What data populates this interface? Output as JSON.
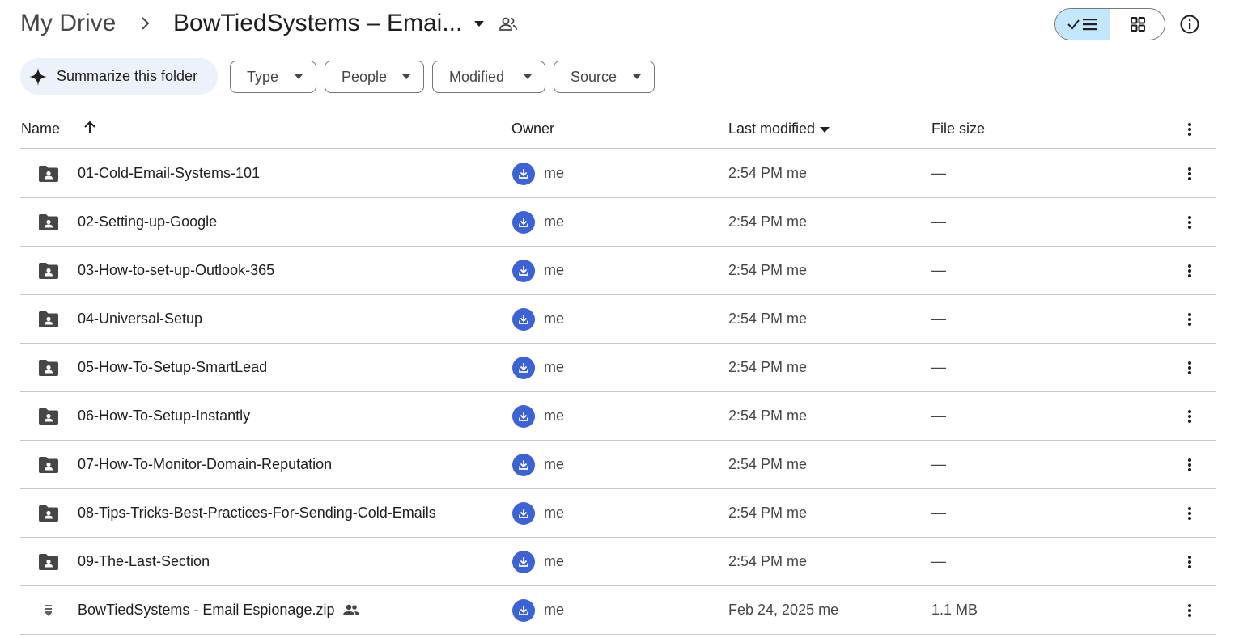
{
  "breadcrumb": {
    "root": "My Drive",
    "current": "BowTiedSystems – Emai..."
  },
  "actions": {
    "summarize_label": "Summarize this folder"
  },
  "filters": [
    {
      "label": "Type"
    },
    {
      "label": "People"
    },
    {
      "label": "Modified"
    },
    {
      "label": "Source"
    }
  ],
  "columns": {
    "name": "Name",
    "owner": "Owner",
    "last_modified": "Last modified",
    "file_size": "File size"
  },
  "rows": [
    {
      "type": "shared-folder",
      "name": "01-Cold-Email-Systems-101",
      "owner": "me",
      "modified": "2:54 PM  me",
      "size": "—"
    },
    {
      "type": "shared-folder",
      "name": "02-Setting-up-Google",
      "owner": "me",
      "modified": "2:54 PM  me",
      "size": "—"
    },
    {
      "type": "shared-folder",
      "name": "03-How-to-set-up-Outlook-365",
      "owner": "me",
      "modified": "2:54 PM  me",
      "size": "—"
    },
    {
      "type": "shared-folder",
      "name": "04-Universal-Setup",
      "owner": "me",
      "modified": "2:54 PM  me",
      "size": "—"
    },
    {
      "type": "shared-folder",
      "name": "05-How-To-Setup-SmartLead",
      "owner": "me",
      "modified": "2:54 PM  me",
      "size": "—"
    },
    {
      "type": "shared-folder",
      "name": "06-How-To-Setup-Instantly",
      "owner": "me",
      "modified": "2:54 PM  me",
      "size": "—"
    },
    {
      "type": "shared-folder",
      "name": "07-How-To-Monitor-Domain-Reputation",
      "owner": "me",
      "modified": "2:54 PM  me",
      "size": "—"
    },
    {
      "type": "shared-folder",
      "name": "08-Tips-Tricks-Best-Practices-For-Sending-Cold-Emails",
      "owner": "me",
      "modified": "2:54 PM  me",
      "size": "—"
    },
    {
      "type": "shared-folder",
      "name": "09-The-Last-Section",
      "owner": "me",
      "modified": "2:54 PM  me",
      "size": "—"
    },
    {
      "type": "zip-file",
      "name": "BowTiedSystems - Email Espionage.zip",
      "shared": true,
      "owner": "me",
      "modified": "Feb 24, 2025  me",
      "size": "1.1 MB"
    }
  ],
  "icons": {
    "breadcrumb_separator": "chevron-right-icon",
    "breadcrumb_menu": "caret-down-icon",
    "shared": "people-icon",
    "list_view": "checkmark-list-icon",
    "grid_view": "grid-icon",
    "info": "info-icon",
    "summarize": "sparkle-icon",
    "sort": "arrow-up-icon",
    "row_menu": "more-vert-icon",
    "owner_avatar": "download-avatar-icon"
  },
  "colors": {
    "view_toggle_active": "#c2e7ff",
    "summarize_bg": "#edf2fa",
    "avatar": "#3b62d6",
    "text_primary": "#1f1f1f",
    "text_secondary": "#444746",
    "divider": "#c4c7c5"
  }
}
